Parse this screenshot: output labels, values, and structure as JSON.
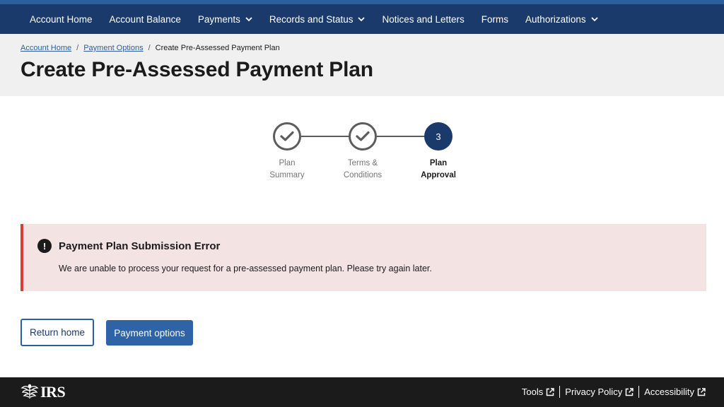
{
  "nav": {
    "items": [
      {
        "label": "Account Home",
        "has_dropdown": false
      },
      {
        "label": "Account Balance",
        "has_dropdown": false
      },
      {
        "label": "Payments",
        "has_dropdown": true
      },
      {
        "label": "Records and Status",
        "has_dropdown": true
      },
      {
        "label": "Notices and Letters",
        "has_dropdown": false
      },
      {
        "label": "Forms",
        "has_dropdown": false
      },
      {
        "label": "Authorizations",
        "has_dropdown": true
      }
    ]
  },
  "breadcrumb": {
    "items": [
      "Account Home",
      "Payment Options"
    ],
    "separator": "/",
    "current": "Create Pre-Assessed Payment Plan"
  },
  "page": {
    "title": "Create Pre-Assessed Payment Plan"
  },
  "stepper": {
    "steps": [
      {
        "line1": "Plan",
        "line2": "Summary",
        "status": "complete",
        "icon": "check-icon"
      },
      {
        "line1": "Terms &",
        "line2": "Conditions",
        "status": "complete",
        "icon": "check-icon"
      },
      {
        "line1": "Plan",
        "line2": "Approval",
        "status": "current",
        "number": "3"
      }
    ]
  },
  "alert": {
    "icon": "exclamation-icon",
    "icon_glyph": "!",
    "title": "Payment Plan Submission Error",
    "body": "We are unable to process your request for a pre-assessed payment plan. Please try again later."
  },
  "actions": {
    "return_home": "Return home",
    "payment_options": "Payment options"
  },
  "footer": {
    "logo_text": "IRS",
    "logo_icon": "irs-eagle-icon",
    "links": [
      "Tools",
      "Privacy Policy",
      "Accessibility"
    ],
    "link_icon": "external-link-icon"
  },
  "colors": {
    "nav_bg": "#1a3a6b",
    "top_strip": "#2e5e9e",
    "header_bg": "#f0f0f0",
    "alert_bg": "#f4e3e3",
    "alert_border": "#d63e3e",
    "primary_button": "#2e63a8",
    "footer_bg": "#1b1b1b"
  }
}
